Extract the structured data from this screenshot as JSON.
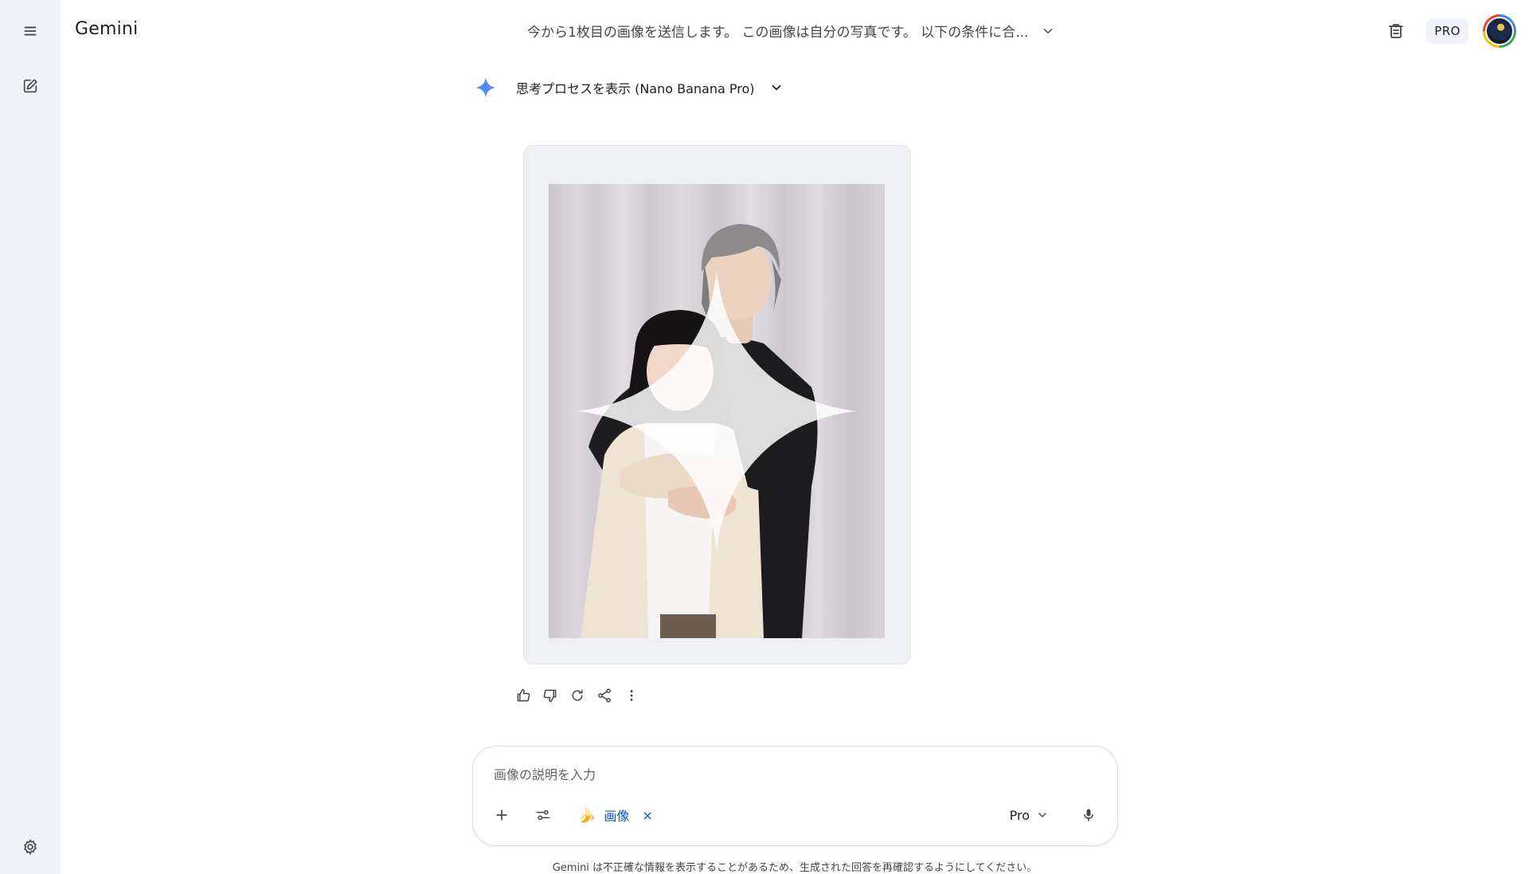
{
  "app": {
    "brand": "Gemini"
  },
  "header": {
    "conversation_title": "今から1枚目の画像を送信します。 この画像は自分の写真です。 以下の条件に合...",
    "plan_badge": "PRO"
  },
  "response": {
    "thinking_label": "思考プロセスを表示 (Nano Banana Pro)"
  },
  "prompt": {
    "placeholder": "画像の説明を入力",
    "value": "",
    "tool_chip_label": "画像",
    "tool_chip_remove": "×",
    "model": "Pro"
  },
  "footer": {
    "disclaimer": "Gemini は不正確な情報を表示することがあるため、生成された回答を再確認するようにしてください。"
  },
  "icons": {
    "menu": "menu-icon",
    "new_chat": "edit-icon",
    "settings": "gear-icon",
    "trash": "trash-icon",
    "spark": "gemini-spark-icon",
    "thumb_up": "thumb-up-icon",
    "thumb_down": "thumb-down-icon",
    "regenerate": "refresh-icon",
    "share": "share-icon",
    "more": "more-vert-icon",
    "add": "plus-icon",
    "tools": "tune-icon",
    "mic": "mic-icon"
  },
  "colors": {
    "rail_bg": "#f0f4f9",
    "accent": "#0b57d0",
    "spark_blue": "#4285f4"
  }
}
